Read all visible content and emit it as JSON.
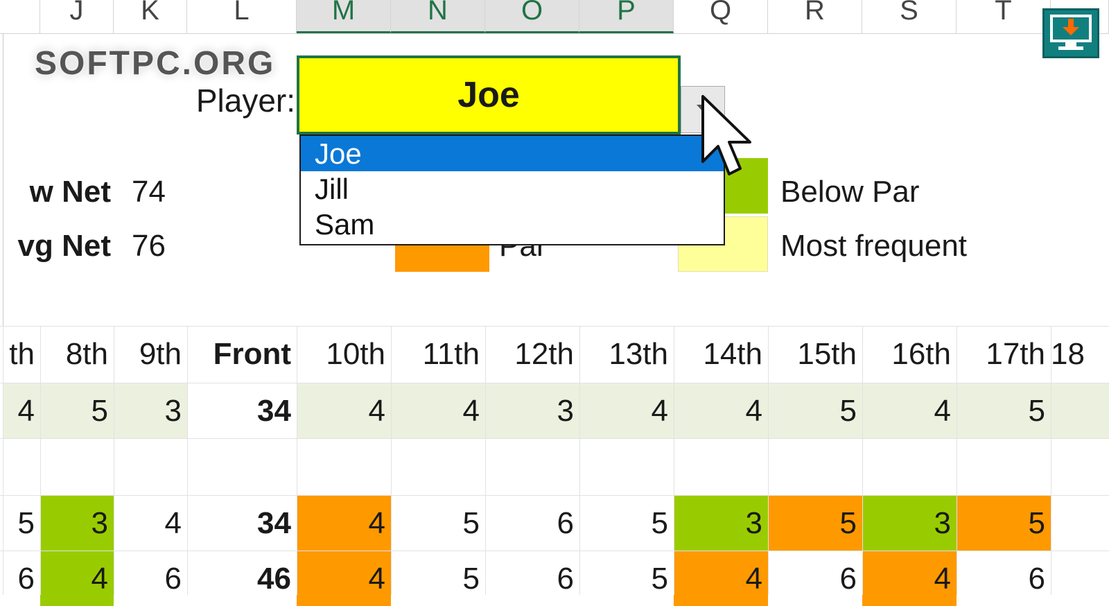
{
  "columns": [
    "J",
    "K",
    "L",
    "M",
    "N",
    "O",
    "P",
    "Q",
    "R",
    "S",
    "T"
  ],
  "watermark": "SOFTPC.ORG",
  "player": {
    "label": "Player:",
    "value": "Joe",
    "options": [
      "Joe",
      "Jill",
      "Sam"
    ],
    "selected_index": 0
  },
  "stats": [
    {
      "label": "w Net",
      "value": "74"
    },
    {
      "label": "vg Net",
      "value": "76"
    }
  ],
  "legend": [
    {
      "label": "Below Par",
      "color": "#99cc00"
    },
    {
      "label": "Most frequent",
      "color": "#ffff99"
    },
    {
      "label": "Par",
      "color": "#ff9900"
    }
  ],
  "holes_header": [
    "th",
    "8th",
    "9th",
    "Front",
    "10th",
    "11th",
    "12th",
    "13th",
    "14th",
    "15th",
    "16th",
    "17th",
    "18"
  ],
  "par_row": [
    "4",
    "5",
    "3",
    "34",
    "4",
    "4",
    "3",
    "4",
    "4",
    "5",
    "4",
    "5",
    ""
  ],
  "score_rows": [
    [
      "5",
      "3",
      "4",
      "34",
      "4",
      "5",
      "6",
      "5",
      "3",
      "5",
      "3",
      "5",
      ""
    ],
    [
      "6",
      "4",
      "6",
      "46",
      "4",
      "5",
      "6",
      "5",
      "4",
      "6",
      "4",
      "6",
      ""
    ]
  ],
  "score_colors": [
    [
      "",
      "#99cc00",
      "",
      "",
      "#ff9900",
      "",
      "",
      "",
      "#99cc00",
      "#ff9900",
      "#99cc00",
      "#ff9900",
      ""
    ],
    [
      "",
      "#99cc00",
      "",
      "",
      "#ff9900",
      "",
      "",
      "",
      "#ff9900",
      "",
      "#ff9900",
      "",
      ""
    ]
  ],
  "colors": {
    "accent_green": "#217346",
    "par_row_bg": "#ebf1de",
    "player_bg": "#ffff00",
    "dropdown_selected": "#0a78d6",
    "download_icon_bg": "#127f7f"
  },
  "icons": [
    "dropdown-arrow-icon",
    "mouse-cursor-icon",
    "download-monitor-icon"
  ]
}
